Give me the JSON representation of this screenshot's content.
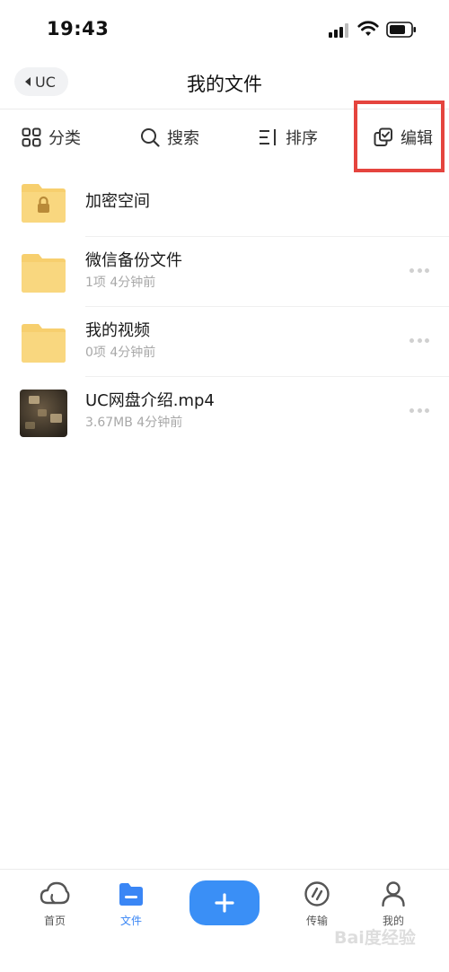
{
  "status_bar": {
    "time": "19:43"
  },
  "nav": {
    "back_label": "UC",
    "title": "我的文件"
  },
  "toolbar": {
    "category_label": "分类",
    "search_label": "搜索",
    "sort_label": "排序",
    "edit_label": "编辑"
  },
  "files": [
    {
      "name": "加密空间",
      "meta": "",
      "icon": "lock-folder-icon"
    },
    {
      "name": "微信备份文件",
      "meta": "1项   4分钟前",
      "icon": "folder-icon"
    },
    {
      "name": "我的视频",
      "meta": "0项   4分钟前",
      "icon": "folder-icon"
    },
    {
      "name": "UC网盘介绍.mp4",
      "meta": "3.67MB   4分钟前",
      "icon": "video-thumbnail"
    }
  ],
  "tabbar": {
    "home_label": "首页",
    "files_label": "文件",
    "transfer_label": "传输",
    "mine_label": "我的"
  },
  "watermark": "Bai度经验",
  "colors": {
    "accent": "#3a8ff6",
    "highlight": "#e5443e",
    "folder": "#f7cf6e"
  }
}
